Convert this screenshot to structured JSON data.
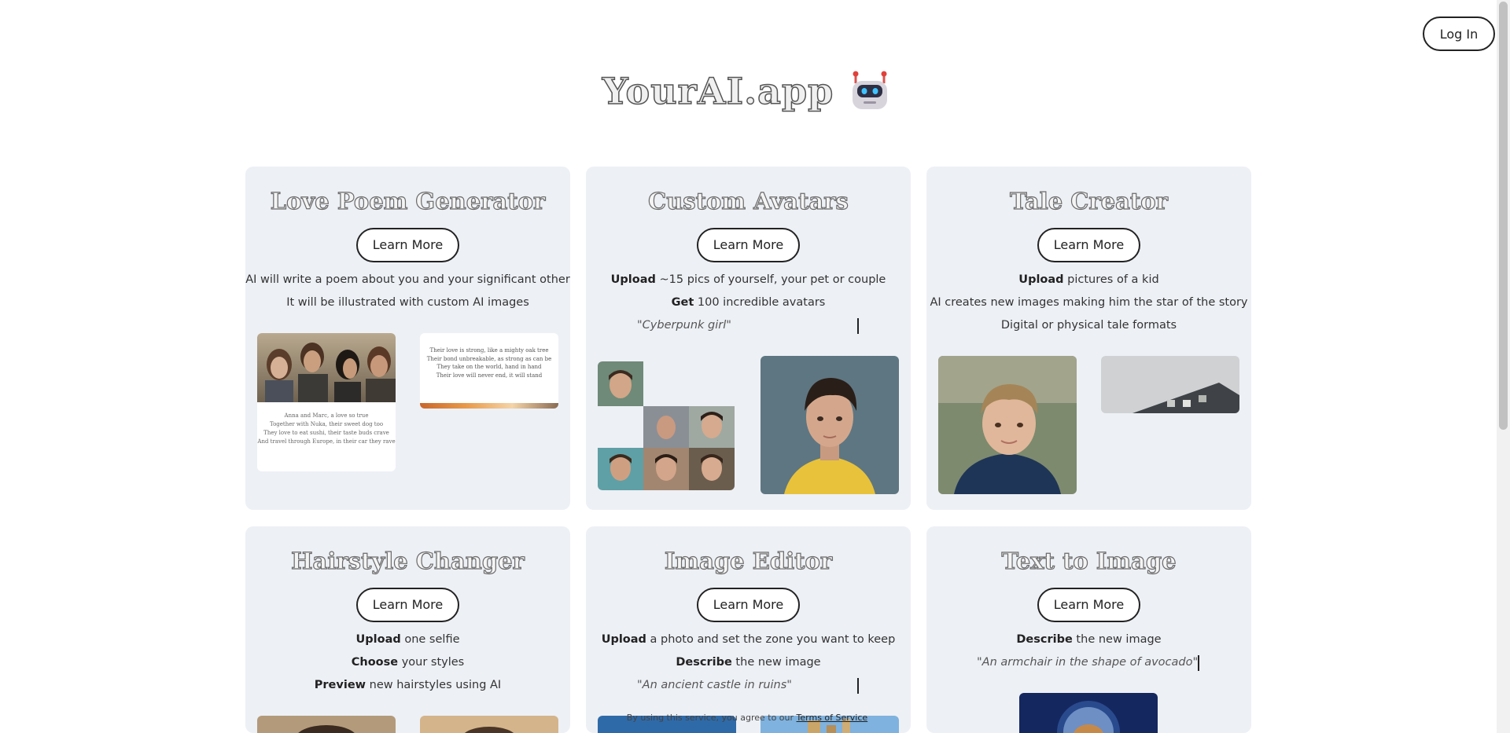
{
  "header": {
    "login_label": "Log In",
    "brand": "YourAI.app",
    "brand_icon": "robot-icon"
  },
  "cards": [
    {
      "title": "Love Poem Generator",
      "button": "Learn More",
      "lines": [
        {
          "plain": "AI will write a poem about you and your significant other"
        },
        {
          "plain": "It will be illustrated with custom AI images"
        }
      ],
      "poem_left": [
        "Anna and Marc, a love so true",
        "Together with Nuka, their sweet dog too",
        "They love to eat sushi, their taste buds crave",
        "And travel through Europe, in their car they rave"
      ],
      "poem_right": [
        "Their love is strong, like a mighty oak tree",
        "Their bond unbreakable, as strong as can be",
        "They take on the world, hand in hand",
        "Their love will never end, it will stand"
      ]
    },
    {
      "title": "Custom Avatars",
      "button": "Learn More",
      "lines": [
        {
          "bold": "Upload",
          "rest": " ~15 pics of yourself, your pet or couple"
        },
        {
          "bold": "Get",
          "rest": " 100 incredible avatars"
        }
      ],
      "quote": "\"Cyberpunk girl\""
    },
    {
      "title": "Tale Creator",
      "button": "Learn More",
      "lines": [
        {
          "bold": "Upload",
          "rest": " pictures of a kid"
        },
        {
          "plain": "AI creates new images making him the star of the story"
        },
        {
          "plain": "Digital or physical tale formats"
        }
      ]
    },
    {
      "title": "Hairstyle Changer",
      "button": "Learn More",
      "lines": [
        {
          "bold": "Upload",
          "rest": " one selfie"
        },
        {
          "bold": "Choose",
          "rest": " your styles"
        },
        {
          "bold": "Preview",
          "rest": " new hairstyles using AI"
        }
      ]
    },
    {
      "title": "Image Editor",
      "button": "Learn More",
      "lines": [
        {
          "bold": "Upload",
          "rest": " a photo and set the zone you want to keep"
        },
        {
          "bold": "Describe",
          "rest": " the new image"
        }
      ],
      "quote": "\"An ancient castle in ruins\""
    },
    {
      "title": "Text to Image",
      "button": "Learn More",
      "lines": [
        {
          "bold": "Describe",
          "rest": " the new image"
        }
      ],
      "quote": "\"An armchair in the shape of avocado\""
    }
  ],
  "footer": {
    "note": "By using this service, you agree to our",
    "link": "Terms of Service"
  }
}
